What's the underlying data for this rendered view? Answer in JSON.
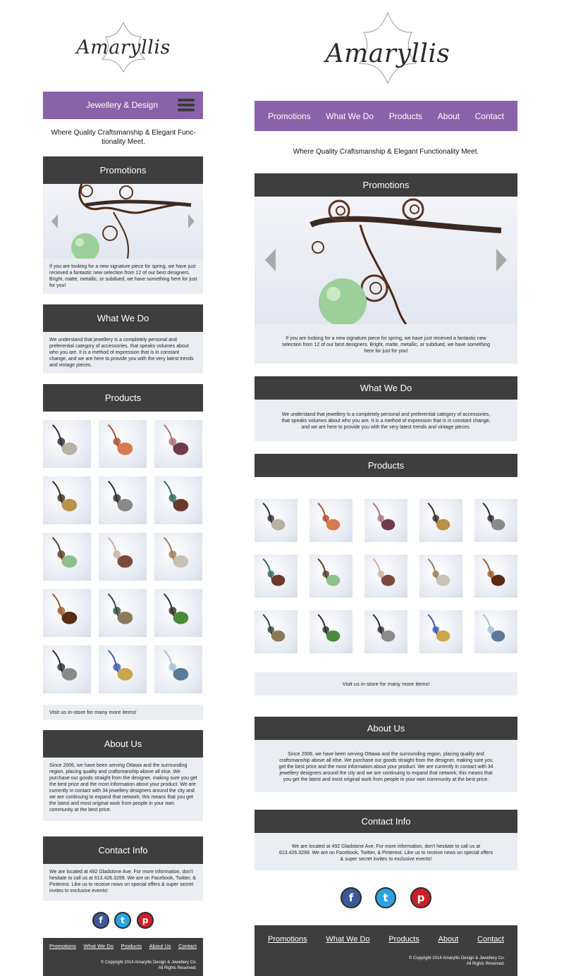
{
  "brand": {
    "name": "Amaryllis",
    "subtitle": "Jewellery & Design"
  },
  "nav": {
    "items": [
      "Promotions",
      "What We Do",
      "Products",
      "About",
      "Contact"
    ]
  },
  "tagline": {
    "mobile": "Where Quality Craftsmanship & Elegant Func- tionality Meet.",
    "desktop": "Where Quality Craftsmanship & Elegant Functionality Meet."
  },
  "promotions": {
    "title": "Promotions",
    "text": "If you are looking for a new signature piece for spring, we have just recieved a fantastic new selection from 12 of our best designers. Bright, matte, metallic, or subdued, we have something here for just for you!"
  },
  "what_we_do": {
    "title": "What We Do",
    "text": "We understand that jewellery is a completely personal and preferential category of accessories, that speaks volumes about who you are. It is a method of expression that is in constant change, and we are here to provide you with the very latest trends and vintage pieces."
  },
  "products": {
    "title": "Products",
    "note": "Visit us in-store for many more items!"
  },
  "about": {
    "title": "About Us",
    "text": "Since 2006, we have been serving Ottawa and the surrounding region, placing quality and craftsmanship above all else. We purchase our goods straight from the designer, making sure you get the best price and the most information about your product. We are currently in contact with 34 jewellery designers around the city and we are continuing to expand that network; this means that you get the latest and most original work from people in your own community at the best price."
  },
  "contact": {
    "title": "Contact Info",
    "text": "We are located at 492 Gladstone Ave. For more information, don't hesitate to call us at 613.426.3299. We are on Facebook, Twitter, & Pinterest. Like us to receive news on special offers & super secret invites to exclusive events!"
  },
  "social": [
    {
      "name": "facebook",
      "glyph": "f",
      "color": "#3b5998"
    },
    {
      "name": "twitter",
      "glyph": "t",
      "color": "#2aa3e0"
    },
    {
      "name": "pinterest",
      "glyph": "p",
      "color": "#cb2027"
    }
  ],
  "footer": {
    "links_mobile": [
      "Promotions",
      "What We Do",
      "Products",
      "About Us",
      "Contact"
    ],
    "links_desktop": [
      "Promotions",
      "What We Do",
      "Products",
      "About",
      "Contact"
    ],
    "copyright_line1": "© Copyright 2014 Amaryllis Design & Jewellery Co.",
    "copyright_line2": "All Rights Reserved."
  },
  "colors": {
    "accent": "#8a62aa",
    "dark": "#3e3e3e",
    "panel": "#eaedf1"
  },
  "product_thumbs": [
    {
      "name": "cord-pendant-necklace",
      "c1": "#2a2a2a",
      "c2": "#b8b0a0"
    },
    {
      "name": "coral-feather-earrings",
      "c1": "#b04a2c",
      "c2": "#d67a50"
    },
    {
      "name": "pink-glass-pendant",
      "c1": "#a9707f",
      "c2": "#6e3a4a"
    },
    {
      "name": "brass-ring",
      "c1": "#3a2a1a",
      "c2": "#b8924a"
    },
    {
      "name": "black-bib-necklace",
      "c1": "#2a2a2a",
      "c2": "#8a8a8a"
    },
    {
      "name": "stone-pendants",
      "c1": "#2f6a5a",
      "c2": "#6a3a2a"
    },
    {
      "name": "wire-cuff-green",
      "c1": "#5a3a22",
      "c2": "#8fc08a"
    },
    {
      "name": "round-charm",
      "c1": "#c9b0a0",
      "c2": "#7a4a3a"
    },
    {
      "name": "bead-earrings",
      "c1": "#9a7a5a",
      "c2": "#c9c2b4"
    },
    {
      "name": "carved-wood-pendant",
      "c1": "#9a5a2a",
      "c2": "#5a2a12"
    },
    {
      "name": "green-bead-bracelet",
      "c1": "#2a4a3a",
      "c2": "#8a7a5a"
    },
    {
      "name": "green-stone-bangle",
      "c1": "#2a2a2a",
      "c2": "#4a8a3a"
    },
    {
      "name": "leaf-pendant",
      "c1": "#2a2a2a",
      "c2": "#8a8a8a"
    },
    {
      "name": "wire-ring-beads",
      "c1": "#3a5ab0",
      "c2": "#c9a64a"
    },
    {
      "name": "blue-glass-charm",
      "c1": "#a8c0d8",
      "c2": "#5a7a9a"
    }
  ]
}
